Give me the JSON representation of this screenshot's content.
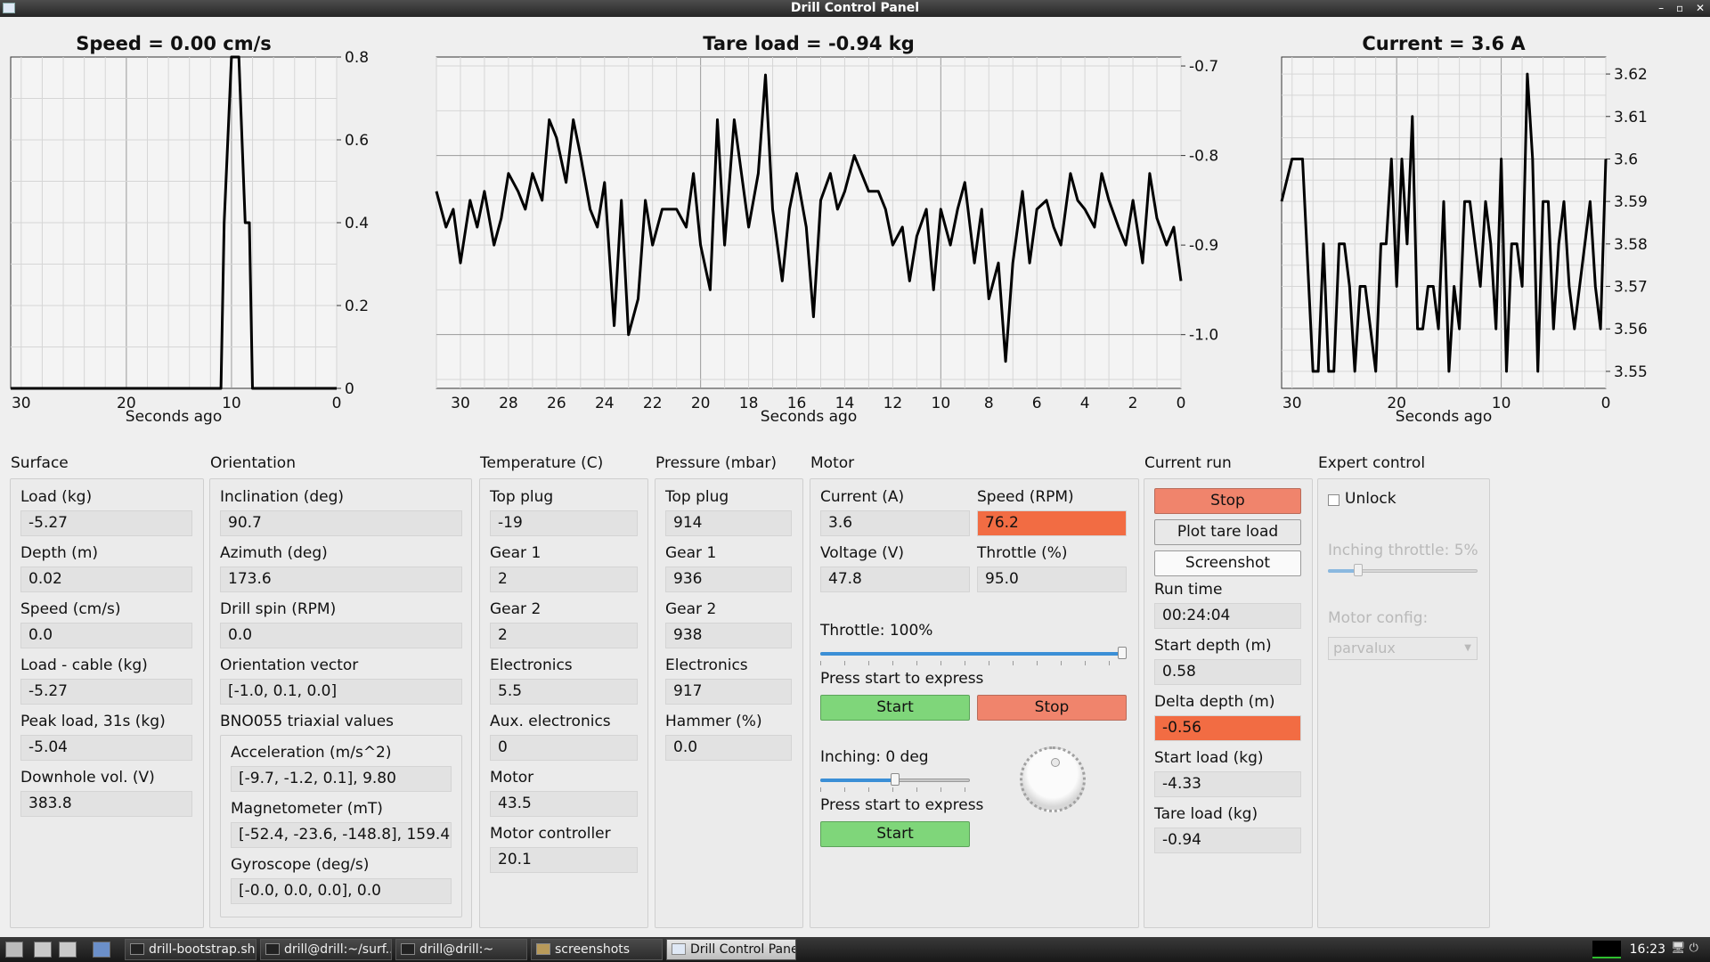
{
  "window": {
    "title": "Drill Control Panel"
  },
  "charts": [
    {
      "id": "speed",
      "title": "Speed = 0.00 cm/s",
      "xlabel": "Seconds ago",
      "x_ticks": [
        "30",
        "20",
        "10",
        "0"
      ],
      "y_ticks": [
        "0.8",
        "0.6",
        "0.4",
        "0.2",
        "0"
      ]
    },
    {
      "id": "tare",
      "title": "Tare load = -0.94 kg",
      "xlabel": "Seconds ago",
      "x_ticks": [
        "30",
        "28",
        "26",
        "24",
        "22",
        "20",
        "18",
        "16",
        "14",
        "12",
        "10",
        "8",
        "6",
        "4",
        "2",
        "0"
      ],
      "y_ticks": [
        "-0.7",
        "-0.8",
        "-0.9",
        "-1.0"
      ]
    },
    {
      "id": "current",
      "title": "Current = 3.6 A",
      "xlabel": "Seconds ago",
      "x_ticks": [
        "30",
        "20",
        "10",
        "0"
      ],
      "y_ticks": [
        "3.62",
        "3.61",
        "3.6",
        "3.59",
        "3.58",
        "3.57",
        "3.56",
        "3.55"
      ]
    }
  ],
  "chart_data": [
    {
      "type": "line",
      "title": "Speed = 0.00 cm/s",
      "xlabel": "Seconds ago",
      "ylabel": "",
      "xlim": [
        31,
        0
      ],
      "ylim": [
        0,
        0.8
      ],
      "grid": true,
      "series": [
        {
          "x": [
            31,
            11,
            10.7,
            10,
            9.3,
            8.7,
            8.3,
            8,
            0
          ],
          "y": [
            0,
            0,
            0.4,
            0.8,
            0.8,
            0.4,
            0.4,
            0,
            0
          ]
        }
      ]
    },
    {
      "type": "line",
      "title": "Tare load = -0.94 kg",
      "xlabel": "Seconds ago",
      "ylabel": "",
      "xlim": [
        31,
        0
      ],
      "ylim": [
        -1.06,
        -0.69
      ],
      "grid": true,
      "series": [
        {
          "x": [
            31,
            30.6,
            30.3,
            30,
            29.6,
            29.3,
            29,
            28.6,
            28.3,
            28,
            27.6,
            27.3,
            27,
            26.6,
            26.3,
            26,
            25.6,
            25.3,
            25,
            24.6,
            24.3,
            24,
            23.6,
            23.3,
            23,
            22.6,
            22.3,
            22,
            21.6,
            21.3,
            21,
            20.6,
            20.3,
            20,
            19.6,
            19.3,
            19,
            18.6,
            18.3,
            18,
            17.6,
            17.3,
            17,
            16.6,
            16.3,
            16,
            15.6,
            15.3,
            15,
            14.6,
            14.3,
            14,
            13.6,
            13.3,
            13,
            12.6,
            12.3,
            12,
            11.6,
            11.3,
            11,
            10.6,
            10.3,
            10,
            9.6,
            9.3,
            9,
            8.6,
            8.3,
            8,
            7.6,
            7.3,
            7,
            6.6,
            6.3,
            6,
            5.6,
            5.3,
            5,
            4.6,
            4.3,
            4,
            3.6,
            3.3,
            3,
            2.6,
            2.3,
            2,
            1.6,
            1.3,
            1,
            0.6,
            0.3,
            0
          ],
          "y": [
            -0.84,
            -0.88,
            -0.86,
            -0.92,
            -0.85,
            -0.88,
            -0.84,
            -0.9,
            -0.87,
            -0.82,
            -0.84,
            -0.86,
            -0.82,
            -0.85,
            -0.76,
            -0.78,
            -0.83,
            -0.76,
            -0.8,
            -0.86,
            -0.88,
            -0.83,
            -0.99,
            -0.85,
            -1.0,
            -0.96,
            -0.85,
            -0.9,
            -0.86,
            -0.86,
            -0.86,
            -0.88,
            -0.82,
            -0.9,
            -0.95,
            -0.76,
            -0.9,
            -0.76,
            -0.82,
            -0.88,
            -0.82,
            -0.71,
            -0.86,
            -0.94,
            -0.86,
            -0.82,
            -0.88,
            -0.98,
            -0.85,
            -0.82,
            -0.86,
            -0.84,
            -0.8,
            -0.82,
            -0.84,
            -0.84,
            -0.86,
            -0.9,
            -0.88,
            -0.94,
            -0.89,
            -0.86,
            -0.95,
            -0.86,
            -0.9,
            -0.86,
            -0.83,
            -0.92,
            -0.86,
            -0.96,
            -0.92,
            -1.03,
            -0.92,
            -0.84,
            -0.92,
            -0.86,
            -0.85,
            -0.88,
            -0.9,
            -0.82,
            -0.85,
            -0.86,
            -0.88,
            -0.82,
            -0.85,
            -0.88,
            -0.9,
            -0.85,
            -0.92,
            -0.82,
            -0.87,
            -0.9,
            -0.88,
            -0.94
          ]
        }
      ]
    },
    {
      "type": "line",
      "title": "Current = 3.6 A",
      "xlabel": "Seconds ago",
      "ylabel": "",
      "xlim": [
        31,
        0
      ],
      "ylim": [
        3.546,
        3.624
      ],
      "grid": true,
      "series": [
        {
          "x": [
            31,
            30,
            29,
            28,
            27.5,
            27,
            26.5,
            26,
            25.5,
            25,
            24.5,
            24,
            23.5,
            23,
            22.5,
            22,
            21.5,
            21,
            20.5,
            20,
            19.5,
            19,
            18.5,
            18,
            17.5,
            17,
            16.5,
            16,
            15.5,
            15,
            14.5,
            14,
            13.5,
            13,
            12.5,
            12,
            11.5,
            11,
            10.5,
            10,
            9.5,
            9,
            8.5,
            8,
            7.5,
            7,
            6.5,
            6,
            5.5,
            5,
            4.5,
            4,
            3.5,
            3,
            2.5,
            2,
            1.5,
            1,
            0.5,
            0
          ],
          "y": [
            3.59,
            3.6,
            3.6,
            3.55,
            3.55,
            3.58,
            3.55,
            3.55,
            3.58,
            3.58,
            3.57,
            3.55,
            3.57,
            3.57,
            3.56,
            3.55,
            3.58,
            3.58,
            3.6,
            3.57,
            3.6,
            3.58,
            3.61,
            3.56,
            3.56,
            3.57,
            3.57,
            3.56,
            3.59,
            3.55,
            3.57,
            3.56,
            3.59,
            3.59,
            3.58,
            3.57,
            3.59,
            3.58,
            3.56,
            3.6,
            3.55,
            3.58,
            3.58,
            3.57,
            3.62,
            3.6,
            3.55,
            3.59,
            3.59,
            3.56,
            3.58,
            3.59,
            3.57,
            3.56,
            3.57,
            3.58,
            3.59,
            3.57,
            3.56,
            3.6
          ]
        }
      ]
    }
  ],
  "surface": {
    "title": "Surface",
    "fields": [
      {
        "label": "Load (kg)",
        "value": "-5.27"
      },
      {
        "label": "Depth (m)",
        "value": "0.02"
      },
      {
        "label": "Speed (cm/s)",
        "value": "0.0"
      },
      {
        "label": "Load - cable (kg)",
        "value": "-5.27"
      },
      {
        "label": "Peak load, 31s (kg)",
        "value": "-5.04"
      },
      {
        "label": "Downhole vol. (V)",
        "value": "383.8"
      }
    ]
  },
  "orientation": {
    "title": "Orientation",
    "fields": [
      {
        "label": "Inclination (deg)",
        "value": "90.7"
      },
      {
        "label": "Azimuth (deg)",
        "value": "173.6"
      },
      {
        "label": "Drill spin (RPM)",
        "value": "0.0"
      },
      {
        "label": "Orientation vector",
        "value": "[-1.0, 0.1, 0.0]"
      }
    ],
    "bno_title": "BNO055 triaxial values",
    "bno_fields": [
      {
        "label": "Acceleration (m/s^2)",
        "value": "[-9.7, -1.2, 0.1], 9.80"
      },
      {
        "label": "Magnetometer (mT)",
        "value": "[-52.4, -23.6, -148.8], 159.4"
      },
      {
        "label": "Gyroscope (deg/s)",
        "value": "[-0.0, 0.0, 0.0], 0.0"
      }
    ]
  },
  "temperature": {
    "title": "Temperature (C)",
    "fields": [
      {
        "label": "Top plug",
        "value": "-19"
      },
      {
        "label": "Gear 1",
        "value": "2"
      },
      {
        "label": "Gear 2",
        "value": "2"
      },
      {
        "label": "Electronics",
        "value": "5.5"
      },
      {
        "label": "Aux. electronics",
        "value": "0"
      },
      {
        "label": "Motor",
        "value": "43.5"
      },
      {
        "label": "Motor controller",
        "value": "20.1"
      }
    ]
  },
  "pressure": {
    "title": "Pressure (mbar)",
    "fields": [
      {
        "label": "Top plug",
        "value": "914"
      },
      {
        "label": "Gear 1",
        "value": "936"
      },
      {
        "label": "Gear 2",
        "value": "938"
      },
      {
        "label": "Electronics",
        "value": "917"
      },
      {
        "label": "Hammer (%)",
        "value": "0.0"
      }
    ]
  },
  "motor": {
    "title": "Motor",
    "current_label": "Current (A)",
    "current_value": "3.6",
    "speed_label": "Speed (RPM)",
    "speed_value": "76.2",
    "voltage_label": "Voltage (V)",
    "voltage_value": "47.8",
    "throttle_label": "Throttle (%)",
    "throttle_value": "95.0",
    "throttle_slider_label": "Throttle: 100%",
    "throttle_slider_value": 1.0,
    "express_hint_1": "Press start to express",
    "start_label": "Start",
    "stop_label": "Stop",
    "inching_label": "Inching: 0 deg",
    "inching_slider_value": 0.5,
    "express_hint_2": "Press start to express",
    "start2_label": "Start"
  },
  "current_run": {
    "title": "Current run",
    "stop_label": "Stop",
    "plot_tare_label": "Plot tare load",
    "screenshot_label": "Screenshot",
    "fields": [
      {
        "label": "Run time",
        "value": "00:24:04"
      },
      {
        "label": "Start depth (m)",
        "value": "0.58"
      },
      {
        "label": "Delta depth (m)",
        "value": "-0.56"
      },
      {
        "label": "Start load (kg)",
        "value": "-4.33"
      },
      {
        "label": "Tare load (kg)",
        "value": "-0.94"
      }
    ]
  },
  "expert": {
    "title": "Expert control",
    "unlock_label": "Unlock",
    "inching_throttle_label": "Inching throttle: 5%",
    "inching_throttle_value": 0.05,
    "motor_config_label": "Motor config:",
    "motor_config_value": "parvalux"
  },
  "taskbar": {
    "items": [
      "drill-bootstrap.sh",
      "drill@drill:~/surf...",
      "drill@drill:~",
      "screenshots",
      "Drill Control Panel"
    ],
    "clock": "16:23"
  },
  "colors": {
    "alert": "#f26c43",
    "start_green": "#7fd67a",
    "stop_red": "#f0846c",
    "slider_blue": "#3b8fd6"
  }
}
